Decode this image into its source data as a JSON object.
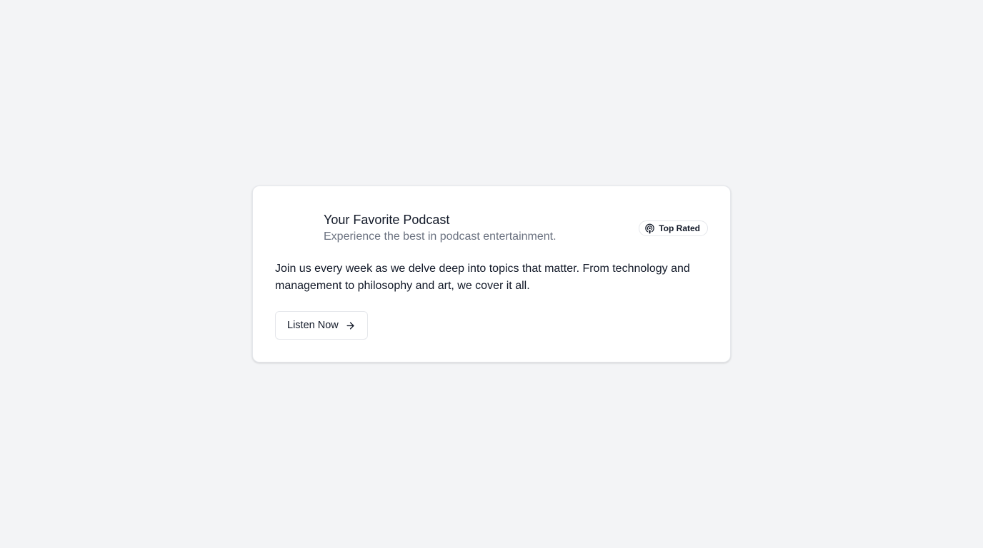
{
  "card": {
    "title": "Your Favorite Podcast",
    "subtitle": "Experience the best in podcast entertainment.",
    "badge": {
      "label": "Top Rated",
      "icon": "podcast-icon"
    },
    "description": "Join us every week as we delve deep into topics that matter. From technology and management to philosophy and art, we cover it all.",
    "button": {
      "label": "Listen Now",
      "icon": "arrow-right-icon"
    }
  }
}
